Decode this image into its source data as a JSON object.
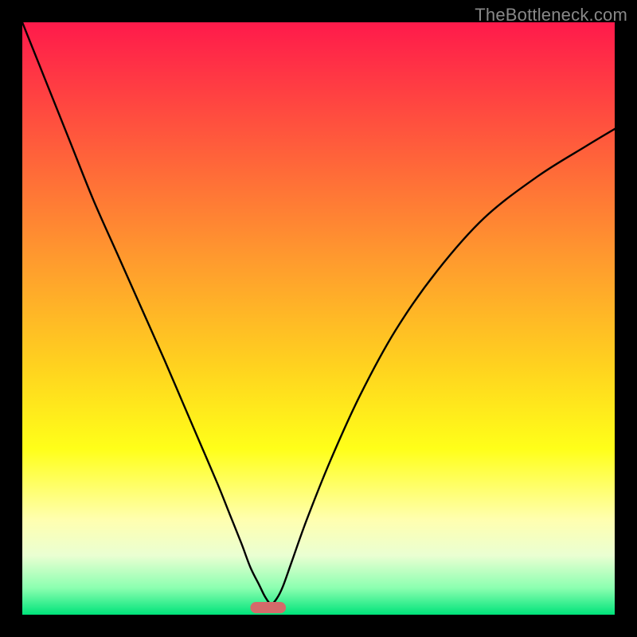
{
  "watermark": "TheBottleneck.com",
  "chart_data": {
    "type": "line",
    "title": "",
    "xlabel": "",
    "ylabel": "",
    "xlim": [
      0,
      100
    ],
    "ylim": [
      0,
      100
    ],
    "grid": false,
    "legend": false,
    "background_gradient": {
      "stops": [
        {
          "offset": 0.0,
          "color": "#ff1a4b"
        },
        {
          "offset": 0.2,
          "color": "#ff5a3c"
        },
        {
          "offset": 0.4,
          "color": "#ff9a2e"
        },
        {
          "offset": 0.58,
          "color": "#ffd21f"
        },
        {
          "offset": 0.72,
          "color": "#ffff19"
        },
        {
          "offset": 0.84,
          "color": "#ffffb0"
        },
        {
          "offset": 0.9,
          "color": "#eaffd2"
        },
        {
          "offset": 0.955,
          "color": "#8bffb0"
        },
        {
          "offset": 1.0,
          "color": "#00e37a"
        }
      ]
    },
    "series": [
      {
        "name": "bottleneck-curve",
        "color": "#000000",
        "x": [
          0,
          4,
          8,
          12,
          16,
          20,
          24,
          27,
          30,
          33,
          35,
          37,
          38.5,
          40,
          41,
          42,
          43,
          44,
          45.5,
          48,
          52,
          57,
          63,
          70,
          78,
          87,
          95,
          100
        ],
        "y": [
          100,
          90,
          80,
          70,
          61,
          52,
          43,
          36,
          29,
          22,
          17,
          12,
          8,
          5,
          3,
          1.8,
          2.8,
          4.8,
          9,
          16,
          26,
          37,
          48,
          58,
          67,
          74,
          79,
          82
        ]
      }
    ],
    "marker": {
      "name": "optimal-range",
      "shape": "pill",
      "color": "#d46a6a",
      "x_center": 41.5,
      "y_center": 1.2,
      "width": 6.0,
      "height": 1.9
    }
  }
}
